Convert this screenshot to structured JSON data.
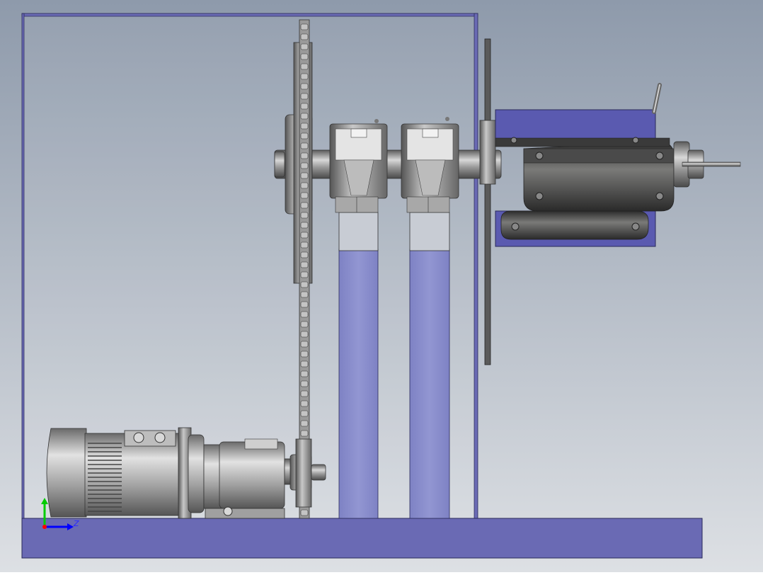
{
  "viewport": {
    "background_top": "#8e9aab",
    "background_bottom": "#dde0e4"
  },
  "colors": {
    "frame_blue": "#6a6ab4",
    "frame_blue_light": "#8a8ecc",
    "frame_edge": "#2a2a5a",
    "steel_dark": "#4a4a4a",
    "steel_mid": "#8c8c8c",
    "steel_light": "#d0d0d0",
    "axis_x": "#0000ff",
    "axis_y": "#00cc00",
    "axis_origin": "#ff0000"
  },
  "triad": {
    "axis_label_z": "Z"
  },
  "components": [
    "base-plate",
    "side-frame",
    "drive-motor",
    "gear-reducer",
    "drive-sprocket",
    "main-sprocket",
    "drive-chain",
    "bearing-block-left",
    "bearing-block-right",
    "main-shaft",
    "separator-disc",
    "spindle-housing",
    "spindle-pin",
    "clamp-lever"
  ]
}
